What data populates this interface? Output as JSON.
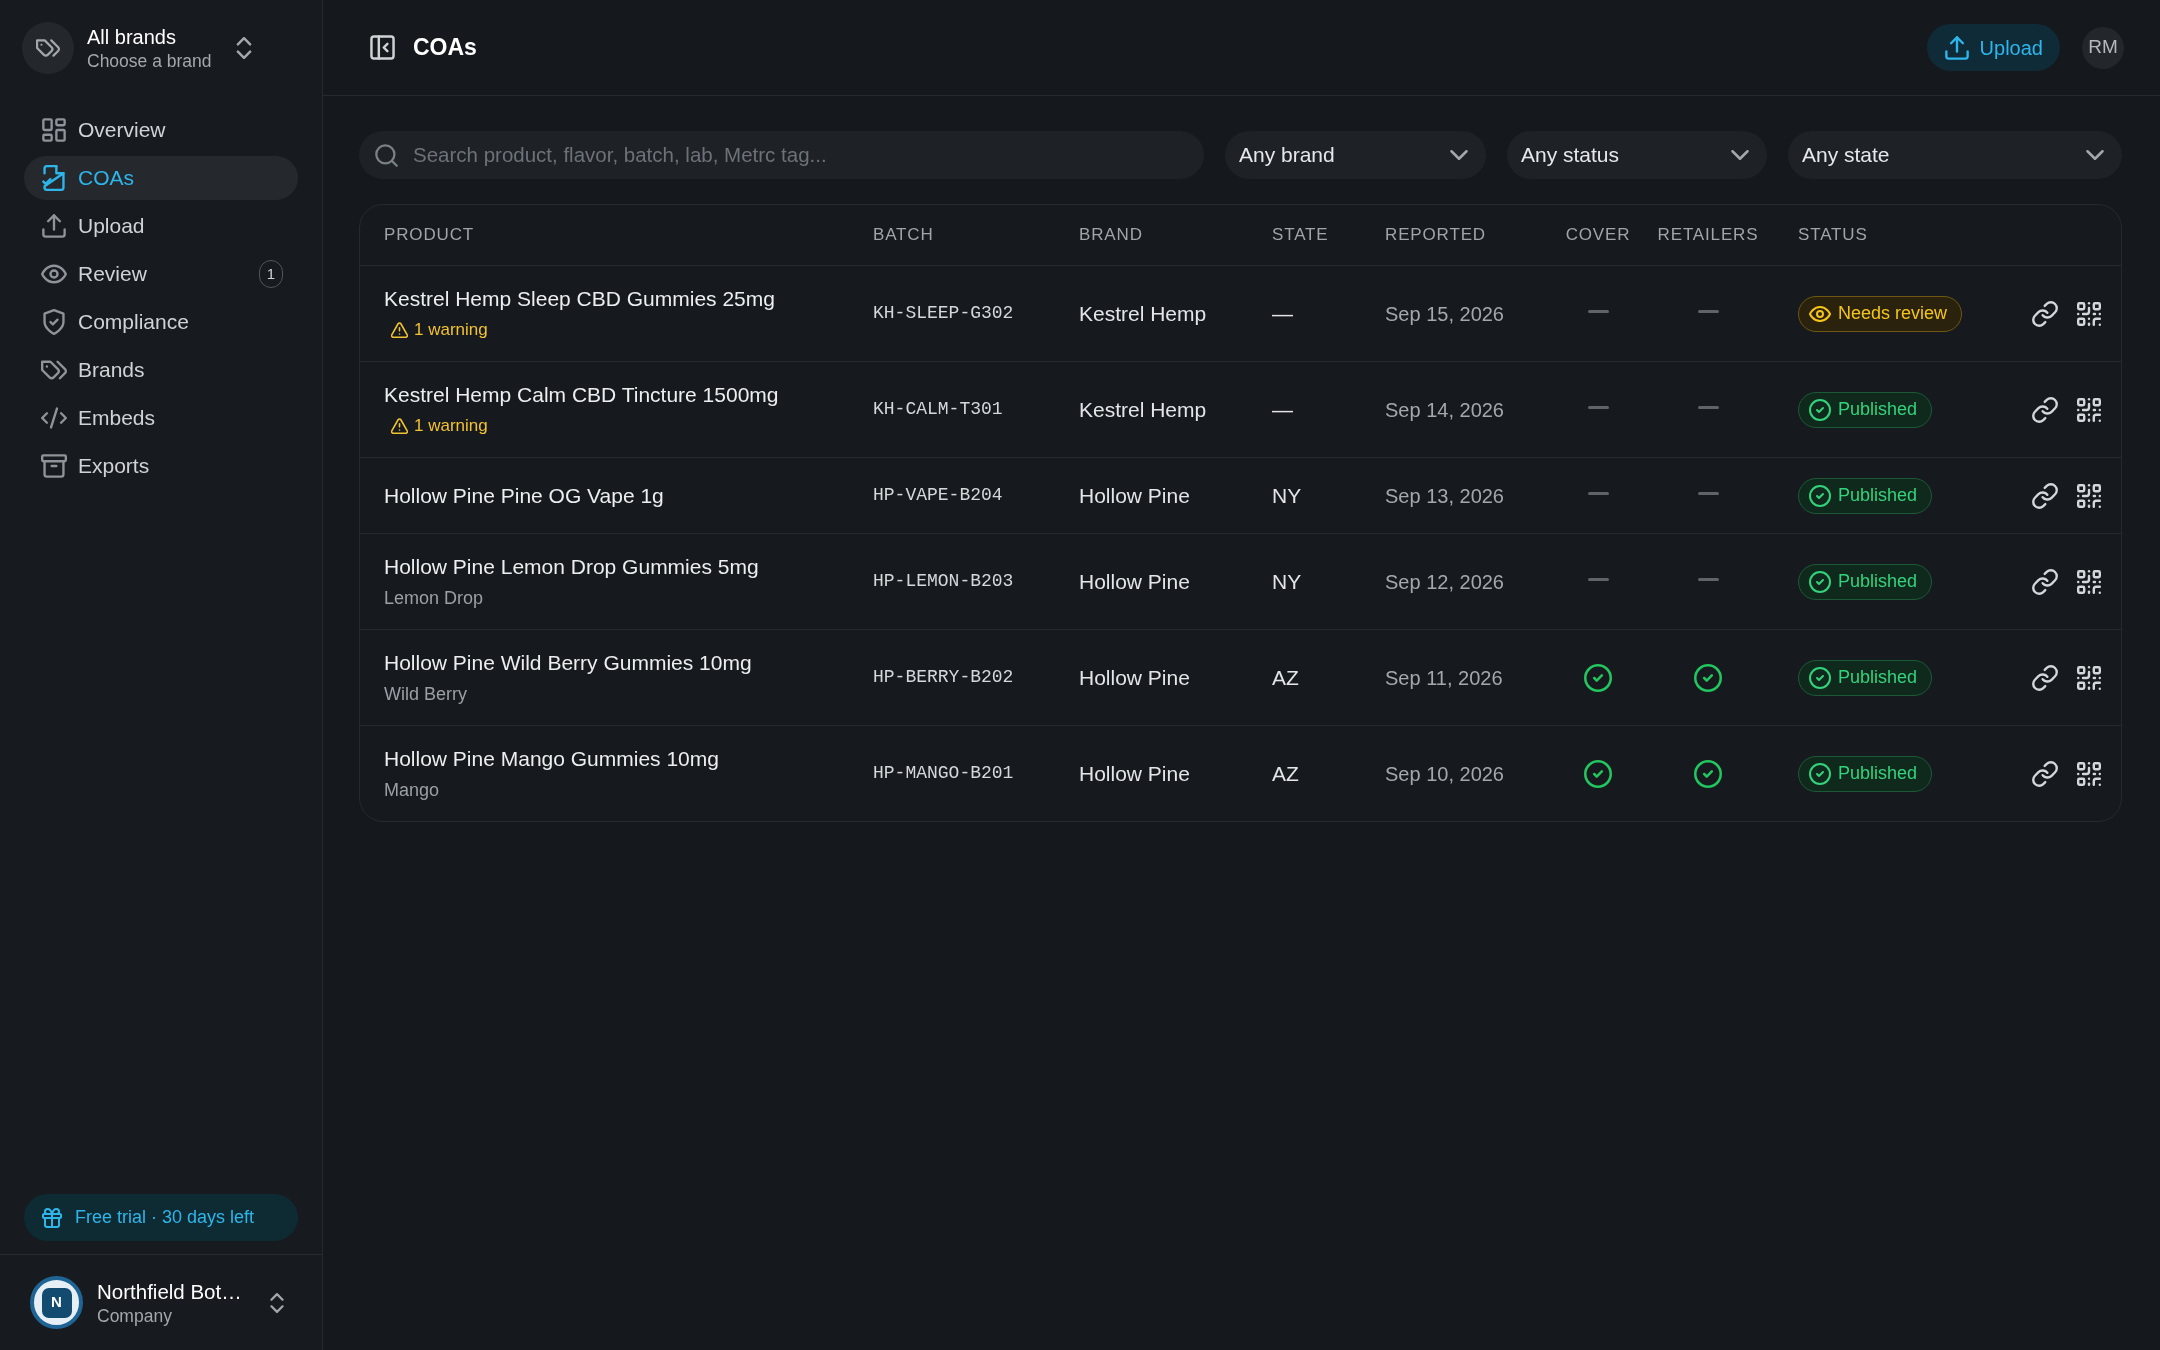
{
  "sidebar": {
    "brand_switcher": {
      "title": "All brands",
      "subtitle": "Choose a brand"
    },
    "nav": [
      {
        "label": "Overview",
        "selected": false
      },
      {
        "label": "COAs",
        "selected": true
      },
      {
        "label": "Upload",
        "selected": false
      },
      {
        "label": "Review",
        "selected": false,
        "badge": "1"
      },
      {
        "label": "Compliance",
        "selected": false
      },
      {
        "label": "Brands",
        "selected": false
      },
      {
        "label": "Embeds",
        "selected": false
      },
      {
        "label": "Exports",
        "selected": false
      }
    ],
    "trial_banner": "Free trial · 30 days left",
    "account": {
      "initial": "N",
      "name": "Northfield Bot…",
      "subtitle": "Company"
    }
  },
  "header": {
    "title": "COAs",
    "upload_button": "Upload",
    "avatar": "RM"
  },
  "filters": {
    "search": {
      "placeholder": "Search product, flavor, batch, lab, Metrc tag..."
    },
    "dropdowns": [
      {
        "label": "Any brand"
      },
      {
        "label": "Any status"
      },
      {
        "label": "Any state"
      }
    ]
  },
  "table": {
    "columns": [
      "PRODUCT",
      "BATCH",
      "BRAND",
      "STATE",
      "REPORTED",
      "COVER",
      "RETAILERS",
      "STATUS"
    ],
    "rows": [
      {
        "product": "Kestrel Hemp Sleep CBD Gummies 25mg",
        "note": {
          "kind": "warning",
          "text": "1 warning"
        },
        "batch": "KH-SLEEP-G302",
        "brand": "Kestrel Hemp",
        "state": "—",
        "reported": "Sep 15, 2026",
        "cover": false,
        "retailers": false,
        "status": {
          "kind": "needs_review",
          "label": "Needs review"
        }
      },
      {
        "product": "Kestrel Hemp Calm CBD Tincture 1500mg",
        "note": {
          "kind": "warning",
          "text": "1 warning"
        },
        "batch": "KH-CALM-T301",
        "brand": "Kestrel Hemp",
        "state": "—",
        "reported": "Sep 14, 2026",
        "cover": false,
        "retailers": false,
        "status": {
          "kind": "published",
          "label": "Published"
        }
      },
      {
        "product": "Hollow Pine Pine OG Vape 1g",
        "batch": "HP-VAPE-B204",
        "brand": "Hollow Pine",
        "state": "NY",
        "reported": "Sep 13, 2026",
        "cover": false,
        "retailers": false,
        "status": {
          "kind": "published",
          "label": "Published"
        }
      },
      {
        "product": "Hollow Pine Lemon Drop Gummies 5mg",
        "note": {
          "kind": "flavor",
          "text": "Lemon Drop"
        },
        "batch": "HP-LEMON-B203",
        "brand": "Hollow Pine",
        "state": "NY",
        "reported": "Sep 12, 2026",
        "cover": false,
        "retailers": false,
        "status": {
          "kind": "published",
          "label": "Published"
        }
      },
      {
        "product": "Hollow Pine Wild Berry Gummies 10mg",
        "note": {
          "kind": "flavor",
          "text": "Wild Berry"
        },
        "batch": "HP-BERRY-B202",
        "brand": "Hollow Pine",
        "state": "AZ",
        "reported": "Sep 11, 2026",
        "cover": true,
        "retailers": true,
        "status": {
          "kind": "published",
          "label": "Published"
        }
      },
      {
        "product": "Hollow Pine Mango Gummies 10mg",
        "note": {
          "kind": "flavor",
          "text": "Mango"
        },
        "batch": "HP-MANGO-B201",
        "brand": "Hollow Pine",
        "state": "AZ",
        "reported": "Sep 10, 2026",
        "cover": true,
        "retailers": true,
        "status": {
          "kind": "published",
          "label": "Published"
        }
      }
    ]
  }
}
